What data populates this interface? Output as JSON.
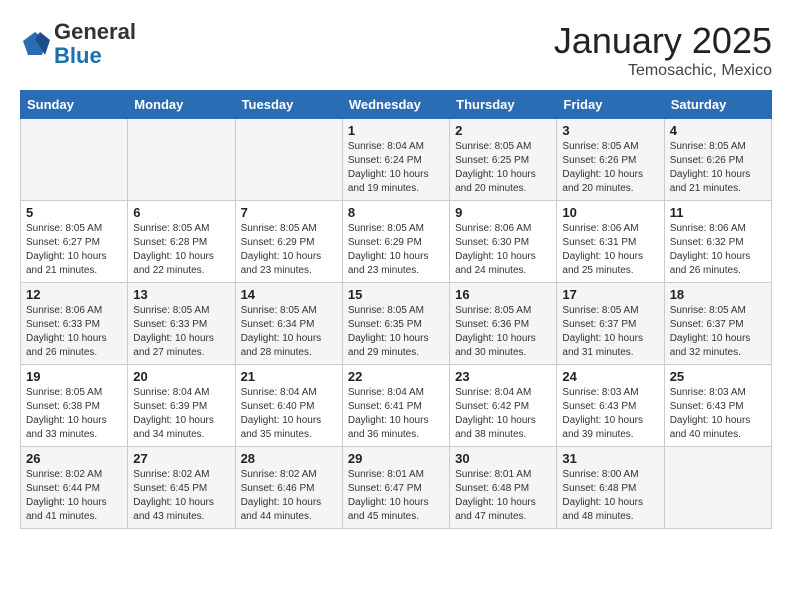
{
  "header": {
    "logo_general": "General",
    "logo_blue": "Blue",
    "month": "January 2025",
    "location": "Temosachic, Mexico"
  },
  "weekdays": [
    "Sunday",
    "Monday",
    "Tuesday",
    "Wednesday",
    "Thursday",
    "Friday",
    "Saturday"
  ],
  "weeks": [
    [
      {
        "day": "",
        "text": ""
      },
      {
        "day": "",
        "text": ""
      },
      {
        "day": "",
        "text": ""
      },
      {
        "day": "1",
        "text": "Sunrise: 8:04 AM\nSunset: 6:24 PM\nDaylight: 10 hours\nand 19 minutes."
      },
      {
        "day": "2",
        "text": "Sunrise: 8:05 AM\nSunset: 6:25 PM\nDaylight: 10 hours\nand 20 minutes."
      },
      {
        "day": "3",
        "text": "Sunrise: 8:05 AM\nSunset: 6:26 PM\nDaylight: 10 hours\nand 20 minutes."
      },
      {
        "day": "4",
        "text": "Sunrise: 8:05 AM\nSunset: 6:26 PM\nDaylight: 10 hours\nand 21 minutes."
      }
    ],
    [
      {
        "day": "5",
        "text": "Sunrise: 8:05 AM\nSunset: 6:27 PM\nDaylight: 10 hours\nand 21 minutes."
      },
      {
        "day": "6",
        "text": "Sunrise: 8:05 AM\nSunset: 6:28 PM\nDaylight: 10 hours\nand 22 minutes."
      },
      {
        "day": "7",
        "text": "Sunrise: 8:05 AM\nSunset: 6:29 PM\nDaylight: 10 hours\nand 23 minutes."
      },
      {
        "day": "8",
        "text": "Sunrise: 8:05 AM\nSunset: 6:29 PM\nDaylight: 10 hours\nand 23 minutes."
      },
      {
        "day": "9",
        "text": "Sunrise: 8:06 AM\nSunset: 6:30 PM\nDaylight: 10 hours\nand 24 minutes."
      },
      {
        "day": "10",
        "text": "Sunrise: 8:06 AM\nSunset: 6:31 PM\nDaylight: 10 hours\nand 25 minutes."
      },
      {
        "day": "11",
        "text": "Sunrise: 8:06 AM\nSunset: 6:32 PM\nDaylight: 10 hours\nand 26 minutes."
      }
    ],
    [
      {
        "day": "12",
        "text": "Sunrise: 8:06 AM\nSunset: 6:33 PM\nDaylight: 10 hours\nand 26 minutes."
      },
      {
        "day": "13",
        "text": "Sunrise: 8:05 AM\nSunset: 6:33 PM\nDaylight: 10 hours\nand 27 minutes."
      },
      {
        "day": "14",
        "text": "Sunrise: 8:05 AM\nSunset: 6:34 PM\nDaylight: 10 hours\nand 28 minutes."
      },
      {
        "day": "15",
        "text": "Sunrise: 8:05 AM\nSunset: 6:35 PM\nDaylight: 10 hours\nand 29 minutes."
      },
      {
        "day": "16",
        "text": "Sunrise: 8:05 AM\nSunset: 6:36 PM\nDaylight: 10 hours\nand 30 minutes."
      },
      {
        "day": "17",
        "text": "Sunrise: 8:05 AM\nSunset: 6:37 PM\nDaylight: 10 hours\nand 31 minutes."
      },
      {
        "day": "18",
        "text": "Sunrise: 8:05 AM\nSunset: 6:37 PM\nDaylight: 10 hours\nand 32 minutes."
      }
    ],
    [
      {
        "day": "19",
        "text": "Sunrise: 8:05 AM\nSunset: 6:38 PM\nDaylight: 10 hours\nand 33 minutes."
      },
      {
        "day": "20",
        "text": "Sunrise: 8:04 AM\nSunset: 6:39 PM\nDaylight: 10 hours\nand 34 minutes."
      },
      {
        "day": "21",
        "text": "Sunrise: 8:04 AM\nSunset: 6:40 PM\nDaylight: 10 hours\nand 35 minutes."
      },
      {
        "day": "22",
        "text": "Sunrise: 8:04 AM\nSunset: 6:41 PM\nDaylight: 10 hours\nand 36 minutes."
      },
      {
        "day": "23",
        "text": "Sunrise: 8:04 AM\nSunset: 6:42 PM\nDaylight: 10 hours\nand 38 minutes."
      },
      {
        "day": "24",
        "text": "Sunrise: 8:03 AM\nSunset: 6:43 PM\nDaylight: 10 hours\nand 39 minutes."
      },
      {
        "day": "25",
        "text": "Sunrise: 8:03 AM\nSunset: 6:43 PM\nDaylight: 10 hours\nand 40 minutes."
      }
    ],
    [
      {
        "day": "26",
        "text": "Sunrise: 8:02 AM\nSunset: 6:44 PM\nDaylight: 10 hours\nand 41 minutes."
      },
      {
        "day": "27",
        "text": "Sunrise: 8:02 AM\nSunset: 6:45 PM\nDaylight: 10 hours\nand 43 minutes."
      },
      {
        "day": "28",
        "text": "Sunrise: 8:02 AM\nSunset: 6:46 PM\nDaylight: 10 hours\nand 44 minutes."
      },
      {
        "day": "29",
        "text": "Sunrise: 8:01 AM\nSunset: 6:47 PM\nDaylight: 10 hours\nand 45 minutes."
      },
      {
        "day": "30",
        "text": "Sunrise: 8:01 AM\nSunset: 6:48 PM\nDaylight: 10 hours\nand 47 minutes."
      },
      {
        "day": "31",
        "text": "Sunrise: 8:00 AM\nSunset: 6:48 PM\nDaylight: 10 hours\nand 48 minutes."
      },
      {
        "day": "",
        "text": ""
      }
    ]
  ]
}
